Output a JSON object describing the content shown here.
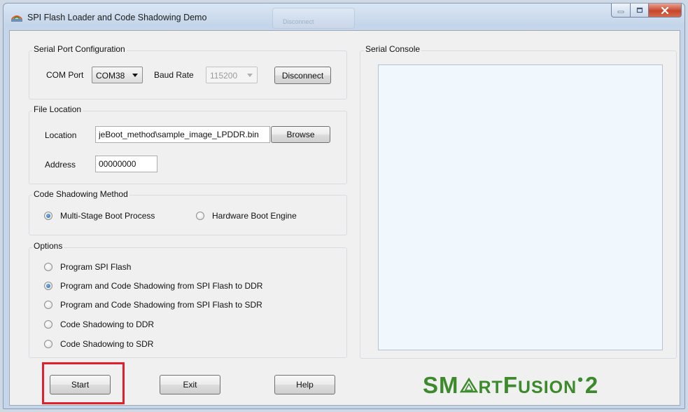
{
  "window": {
    "title": "SPI Flash Loader and Code Shadowing Demo",
    "ghost_tab": "Disconnect"
  },
  "serial_port": {
    "legend": "Serial Port Configuration",
    "com_label": "COM Port",
    "com_value": "COM38",
    "baud_label": "Baud Rate",
    "baud_value": "115200",
    "disconnect_label": "Disconnect"
  },
  "file_location": {
    "legend": "File Location",
    "location_label": "Location",
    "location_value": "jeBoot_method\\sample_image_LPDDR.bin",
    "browse_label": "Browse",
    "address_label": "Address",
    "address_value": "00000000"
  },
  "shadowing": {
    "legend": "Code Shadowing Method",
    "options": [
      "Multi-Stage Boot Process",
      "Hardware Boot Engine"
    ],
    "selected": 0
  },
  "options": {
    "legend": "Options",
    "items": [
      "Program SPI Flash",
      "Program and Code Shadowing from SPI Flash to DDR",
      "Program and Code Shadowing from SPI Flash to SDR",
      "Code Shadowing to DDR",
      "Code Shadowing to SDR"
    ],
    "selected": 1
  },
  "console": {
    "legend": "Serial Console"
  },
  "buttons": {
    "start": "Start",
    "exit": "Exit",
    "help": "Help"
  },
  "logo": {
    "part1": "SM",
    "part2": "RT",
    "part3": "F",
    "part4": "USION",
    "part5": "2"
  },
  "colors": {
    "highlight": "#e0202a",
    "logo_green": "#3d8a2c",
    "console_bg": "#f0f8fd"
  }
}
